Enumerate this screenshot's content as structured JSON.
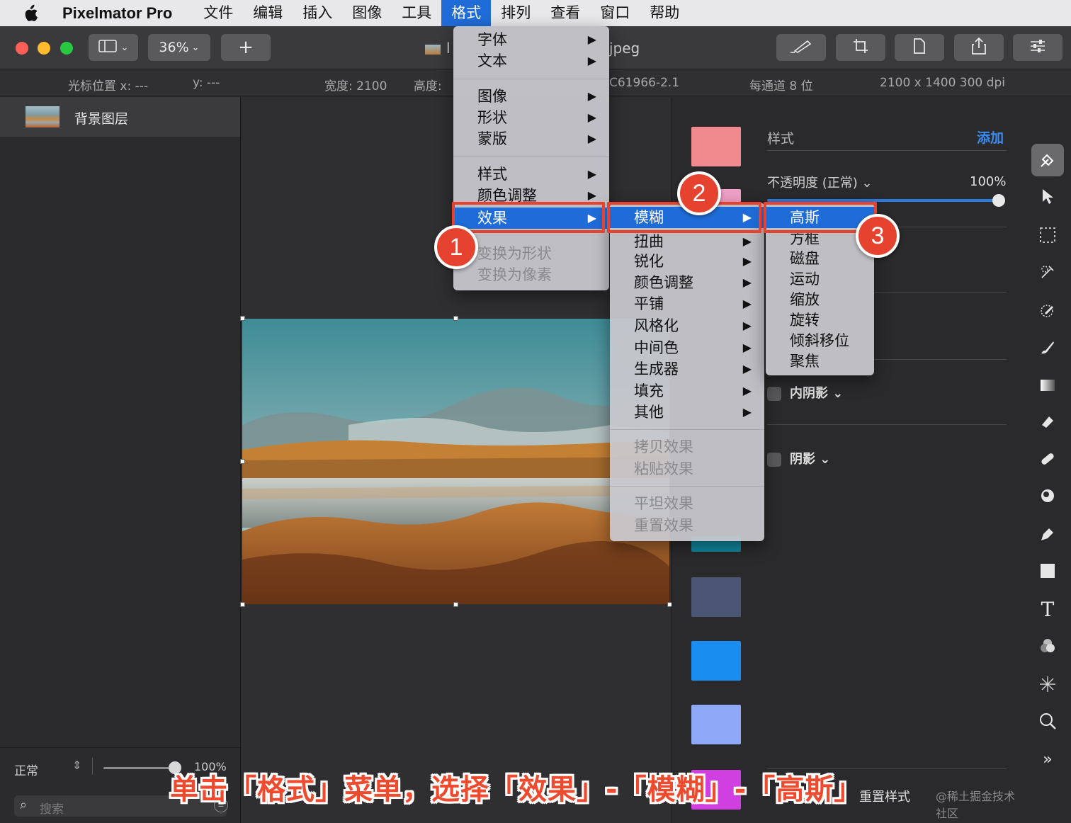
{
  "menubar": {
    "app_name": "Pixelmator Pro",
    "items": [
      "文件",
      "编辑",
      "插入",
      "图像",
      "工具",
      "格式",
      "排列",
      "查看",
      "窗口",
      "帮助"
    ]
  },
  "toolbar": {
    "zoom": "36%",
    "add_label": "+",
    "doc_title": "l",
    "doc_title_suffix": "jpeg"
  },
  "infobar": {
    "cursor_x": "光标位置 x:  ---",
    "cursor_y": "y:  ---",
    "width": "宽度:  2100",
    "height": "高度:",
    "profile": "C61966-2.1",
    "depth": "每通道 8 位",
    "size": "2100 x 1400 300 dpi"
  },
  "layers": {
    "layer_name": "背景图层",
    "blend_mode": "正常",
    "opacity": "100%",
    "search_placeholder": "搜索"
  },
  "styles": {
    "header": "样式",
    "add": "添加",
    "opacity_label": "不透明度 (正常) ⌄",
    "opacity_value": "100%",
    "inner_shadow": "内阴影 ⌄",
    "shadow": "阴影 ⌄",
    "reset": "重置样式",
    "watermark": "@稀土掘金技术社区",
    "swatch_colors": [
      "#f08a8e",
      "#f0a0c8",
      "#0f8aa0",
      "#4a5674",
      "#1a8ef0",
      "#8fa8f8",
      "#d040e0"
    ]
  },
  "format_menu": {
    "items": [
      "字体",
      "文本",
      "图像",
      "形状",
      "蒙版",
      "样式",
      "颜色调整",
      "效果",
      "变换为形状",
      "变换为像素"
    ]
  },
  "effects_menu": {
    "items": [
      "模糊",
      "扭曲",
      "锐化",
      "颜色调整",
      "平铺",
      "风格化",
      "中间色",
      "生成器",
      "填充",
      "其他",
      "拷贝效果",
      "粘贴效果",
      "平坦效果",
      "重置效果"
    ]
  },
  "blur_menu": {
    "items": [
      "高斯",
      "方框",
      "磁盘",
      "运动",
      "缩放",
      "旋转",
      "倾斜移位",
      "聚焦"
    ]
  },
  "annotations": {
    "badge1": "1",
    "badge2": "2",
    "badge3": "3",
    "caption": "单击「格式」菜单，选择「效果」-「模糊」-「高斯」"
  },
  "colors": {
    "accent": "#1f6cd8",
    "annotation_red": "#e5432f"
  }
}
